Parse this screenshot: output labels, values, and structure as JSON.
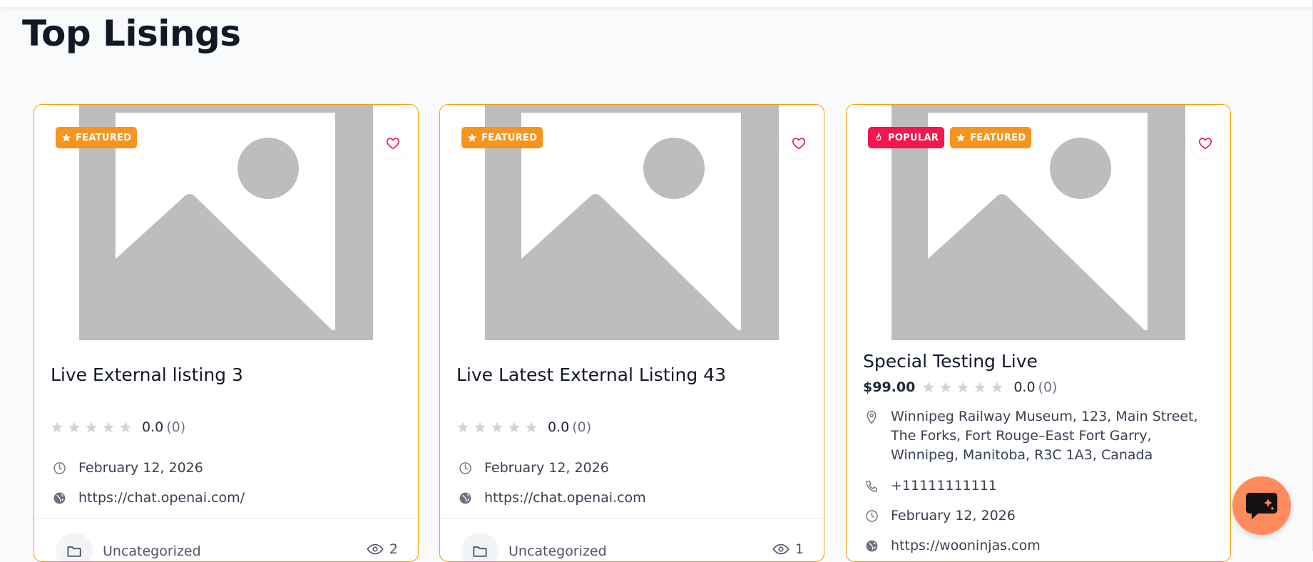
{
  "section": {
    "title": "Top Lisings"
  },
  "colors": {
    "accent": "#f7941d",
    "popular": "#f5154f",
    "border": "#f59e0b",
    "fab": "#ff8a5c",
    "heart": "#e11d48"
  },
  "cards": [
    {
      "badges": [
        {
          "type": "featured",
          "label": "FEATURED"
        }
      ],
      "title": "Live External listing 3",
      "price": "",
      "rating": {
        "score": "0.0",
        "count": "(0)"
      },
      "address": "",
      "phone": "",
      "date": "February 12, 2026",
      "website": "https://chat.openai.com/",
      "category": "Uncategorized",
      "views": "2"
    },
    {
      "badges": [
        {
          "type": "featured",
          "label": "FEATURED"
        }
      ],
      "title": "Live Latest External Listing 43",
      "price": "",
      "rating": {
        "score": "0.0",
        "count": "(0)"
      },
      "address": "",
      "phone": "",
      "date": "February 12, 2026",
      "website": "https://chat.openai.com",
      "category": "Uncategorized",
      "views": "1"
    },
    {
      "badges": [
        {
          "type": "popular",
          "label": "POPULAR"
        },
        {
          "type": "featured",
          "label": "FEATURED"
        }
      ],
      "title": "Special Testing Live",
      "price": "$99.00",
      "rating": {
        "score": "0.0",
        "count": "(0)"
      },
      "address": "Winnipeg Railway Museum, 123, Main Street, The Forks, Fort Rouge–East Fort Garry, Winnipeg, Manitoba, R3C 1A3, Canada",
      "phone": "+11111111111",
      "date": "February 12, 2026",
      "website": "https://wooninjas.com",
      "category": "",
      "views": ""
    }
  ]
}
